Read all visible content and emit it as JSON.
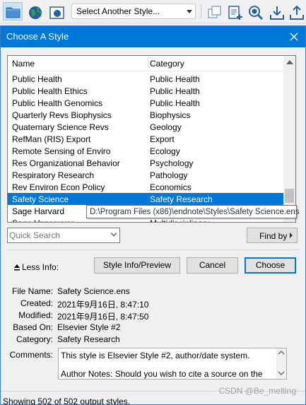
{
  "toolbar": {
    "style_select_value": "Select Another Style...",
    "icons": [
      "folder-icon",
      "globe-icon",
      "web-library-icon",
      "copy-icon",
      "new-reference-icon",
      "find-icon",
      "download-icon",
      "upload-icon"
    ]
  },
  "dialog": {
    "title": "Choose A Style",
    "columns": {
      "name": "Name",
      "category": "Category"
    },
    "rows": [
      {
        "name": "Public Health",
        "category": "Public Health"
      },
      {
        "name": "Public Health Ethics",
        "category": "Public Health"
      },
      {
        "name": "Public Health Genomics",
        "category": "Public Health"
      },
      {
        "name": "Quarterly Revs Biophysics",
        "category": "Biophysics"
      },
      {
        "name": "Quaternary Science Revs",
        "category": "Geology"
      },
      {
        "name": "RefMan (RIS) Export",
        "category": "Export"
      },
      {
        "name": "Remote Sensing of Enviro",
        "category": "Ecology"
      },
      {
        "name": "Res Organizational Behavior",
        "category": "Psychology"
      },
      {
        "name": "Respiratory Research",
        "category": "Pathology"
      },
      {
        "name": "Rev Environ Econ Policy",
        "category": "Economics"
      },
      {
        "name": "Safety Science",
        "category": "Safety Research"
      },
      {
        "name": "Sage Harvard",
        "category": ""
      },
      {
        "name": "Sage Vancouver",
        "category": "Multidisciplinary"
      }
    ],
    "selected_index": 10,
    "tooltip": "D:\\Program Files (x86)\\endnote\\Styles\\Safety Science.ens",
    "quick_search_placeholder": "Quick Search",
    "find_by_label": "Find by",
    "less_info_label": "Less Info:",
    "buttons": {
      "style_info": "Style Info/Preview",
      "cancel": "Cancel",
      "choose": "Choose"
    },
    "info": {
      "file_name_label": "File Name:",
      "file_name": "Safety Science.ens",
      "created_label": "Created:",
      "created": "2021年9月16日, 8:47:10",
      "modified_label": "Modified:",
      "modified": "2021年9月16日, 8:47:50",
      "based_on_label": "Based On:",
      "based_on": "Elsevier Style #2",
      "category_label": "Category:",
      "category": "Safety Research",
      "comments_label": "Comments:",
      "comments_line1": "This style is Elsevier Style #2, author/date system.",
      "comments_line2": "Author Notes: Should you wish to cite a source on the"
    },
    "status": "Showing 502 of 502 output styles."
  },
  "watermark": "CSDN @Be_melting",
  "colors": {
    "accent": "#0078d7",
    "selection": "#0078d7"
  }
}
